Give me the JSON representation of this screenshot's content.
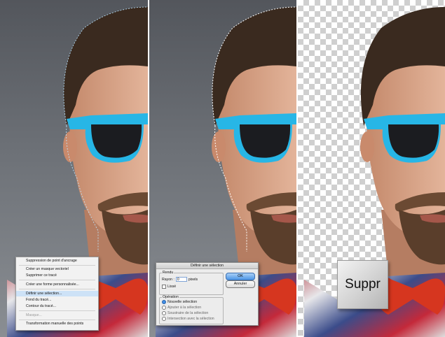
{
  "context_menu": {
    "items": [
      {
        "label": "Suppression de point d'ancrage",
        "disabled": false
      },
      {
        "label": "Créer un masque vectoriel",
        "disabled": false
      },
      {
        "label": "Supprimer ce tracé",
        "disabled": false
      },
      {
        "label": "Créer une forme personnalisée...",
        "disabled": false
      },
      {
        "label": "Définir une sélection...",
        "disabled": false,
        "highlighted": true
      },
      {
        "label": "Fond du tracé...",
        "disabled": false
      },
      {
        "label": "Contour du tracé...",
        "disabled": false
      },
      {
        "label": "Masque...",
        "disabled": true
      },
      {
        "label": "Transformation manuelle des points",
        "disabled": false
      }
    ]
  },
  "dialog": {
    "title": "Définir une sélection",
    "rendu": {
      "legend": "Rendu",
      "rayon_label": "Rayon :",
      "rayon_value": "0",
      "unit": "pixels",
      "lisse_label": "Lissé"
    },
    "operation": {
      "legend": "Opération",
      "options": [
        {
          "label": "Nouvelle sélection",
          "selected": true
        },
        {
          "label": "Ajouter à la sélection",
          "selected": false
        },
        {
          "label": "Soustraire de la sélection",
          "selected": false
        },
        {
          "label": "Intersection avec la sélection",
          "selected": false
        }
      ]
    },
    "ok_label": "OK",
    "cancel_label": "Annuler"
  },
  "key_label": "Suppr",
  "colors": {
    "sunglasses": "#27b6e6",
    "bowtie": "#d6361f",
    "hair": "#3a2a1f",
    "skin": "#d9a98c",
    "selection_highlight": "#cde2f7",
    "default_button": "#4d95e6"
  }
}
